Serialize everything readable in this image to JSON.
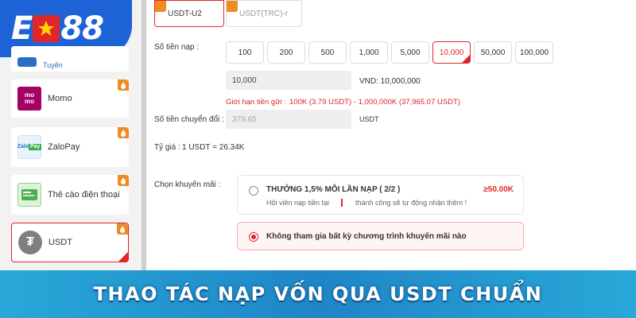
{
  "logo": {
    "left": "E",
    "right": "88"
  },
  "sidebar": {
    "items": [
      {
        "label": "Tuyến",
        "icon": "bank-icon"
      },
      {
        "label": "Momo",
        "icon": "momo-icon",
        "icon_text": "mo\nmo"
      },
      {
        "label": "ZaloPay",
        "icon": "zalopay-icon",
        "icon_text": "Zalo Pay"
      },
      {
        "label": "Thẻ cào điện thoại",
        "icon": "phone-card-icon"
      },
      {
        "label": "USDT",
        "icon": "tether-icon",
        "active": true
      }
    ]
  },
  "tabs": [
    {
      "label": "USDT-U2",
      "active": true
    },
    {
      "label": "USDT(TRC)-r",
      "active": false
    }
  ],
  "deposit": {
    "amount_label": "Số tiền nạp :",
    "amounts": [
      "100",
      "200",
      "500",
      "1,000",
      "5,000",
      "10,000",
      "50,000",
      "100,000"
    ],
    "selected_amount": "10,000",
    "input_value": "10,000",
    "vnd_text": "VND: 10,000,000",
    "limit_label": "Giới hạn tiền gửi :",
    "limit_value": "100K (3.79 USDT) - 1,000,000K (37,965.07 USDT)",
    "convert_label": "Số tiền chuyển đổi :",
    "convert_value": "379.65",
    "convert_unit": "USDT",
    "rate_label": "Tỷ giá :",
    "rate_value": "1  USDT  =  26.34K"
  },
  "promotion": {
    "label": "Chọn khuyến mãi :",
    "options": [
      {
        "title": "THƯỞNG 1,5% MỖI LẦN NẠP ( 2/2 )",
        "desc_left": "Hội viên nạp tiền tại",
        "desc_right": "thành công sẽ tự động nhận thêm !",
        "amount": "≥50.00K",
        "selected": false
      },
      {
        "title": "Không tham gia bất kỳ chương trình khuyến mãi nào",
        "selected": true
      }
    ]
  },
  "banner": {
    "text": "THAO TÁC NẠP VỐN QUA USDT CHUẨN"
  },
  "colors": {
    "accent": "#e0262b",
    "brand_blue": "#1e63d6",
    "hot_badge": "#f08a24",
    "banner": "#1f86c7"
  }
}
